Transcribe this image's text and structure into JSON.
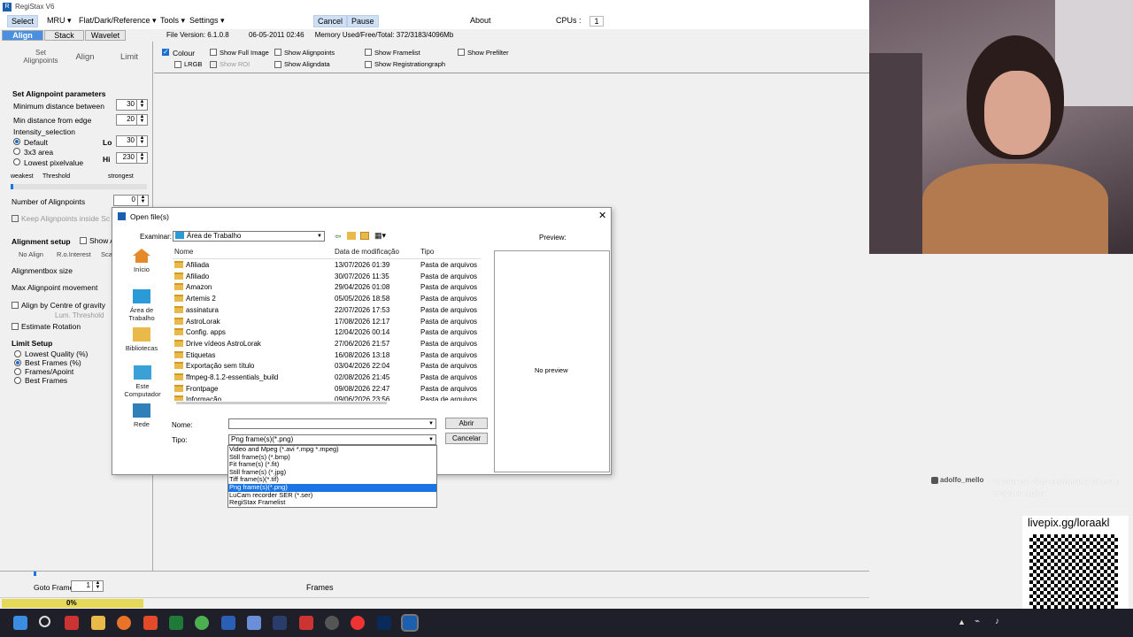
{
  "window": {
    "title": "RegiStax V6"
  },
  "menubar": {
    "select": "Select",
    "mru": "MRU ▾",
    "flat": "Flat/Dark/Reference ▾",
    "tools": "Tools ▾",
    "settings": "Settings ▾",
    "cancel": "Cancel",
    "pause": "Pause",
    "about": "About",
    "cpus_label": "CPUs :",
    "cpus_value": "1"
  },
  "tabs": {
    "align": "Align",
    "stack": "Stack",
    "wavelet": "Wavelet"
  },
  "fileinfo": {
    "version": "File Version: 6.1.0.8",
    "date": "06-05-2011 02:46",
    "memory": "Memory Used/Free/Total: 372/3183/4096Mb"
  },
  "left": {
    "set_alignpoints": "Set Alignpoints",
    "align": "Align",
    "limit": "Limit",
    "params_title": "Set Alignpoint parameters",
    "min_dist_between": "Minimum distance between",
    "min_dist_between_val": "30",
    "min_dist_edge": "Min distance from edge",
    "min_dist_edge_val": "20",
    "intensity": "Intensity_selection",
    "default": "Default",
    "area3x3": "3x3 area",
    "lowest": "Lowest pixelvalue",
    "lo": "Lo",
    "lo_val": "30",
    "hi": "Hi",
    "hi_val": "230",
    "weakest": "weakest",
    "threshold": "Threshold",
    "strongest": "strongest",
    "num_alignpoints": "Number of Alignpoints",
    "num_alignpoints_val": "0",
    "keep_inside": "Keep Alignpoints inside Sc",
    "alignment_setup": "Alignment setup",
    "show_a": "Show A",
    "no_align": "No Align",
    "roi": "R.o.Interest",
    "sca": "Sca",
    "alignbox_size": "Alignmentbox size",
    "max_movement": "Max Alignpoint movement",
    "align_centre": "Align by Centre of gravity",
    "lum_threshold": "Lum. Threshold",
    "estimate_rotation": "Estimate Rotation",
    "limit_setup": "Limit Setup",
    "lowest_quality": "Lowest Quality (%)",
    "best_frames_pct": "Best Frames (%)",
    "frames_apoint": "Frames/Apoint",
    "best_frames": "Best Frames"
  },
  "topchecks": {
    "colour": "Colour",
    "lrgb": "LRGB",
    "show_full": "Show Full Image",
    "show_roi": "Show ROI",
    "show_alignpoints": "Show Alignpoints",
    "show_aligndata": "Show Aligndata",
    "show_framelist": "Show Framelist",
    "show_reggraph": "Show Registrationgraph",
    "show_prefilter": "Show Prefilter"
  },
  "dialog": {
    "title": "Open file(s)",
    "examinar": "Examinar:",
    "location": "Área de Trabalho",
    "preview": "Preview:",
    "no_preview": "No preview",
    "nav": [
      {
        "label": "Início"
      },
      {
        "label": "Área de Trabalho"
      },
      {
        "label": "Bibliotecas"
      },
      {
        "label": "Este Computador"
      },
      {
        "label": "Rede"
      }
    ],
    "headers": {
      "name": "Nome",
      "date": "Data de modificação",
      "type": "Tipo"
    },
    "files": [
      {
        "name": "Afiliada",
        "date": "13/07/2026 01:39",
        "type": "Pasta de arquivos"
      },
      {
        "name": "Afiliado",
        "date": "30/07/2026 11:35",
        "type": "Pasta de arquivos"
      },
      {
        "name": "Amazon",
        "date": "29/04/2026 01:08",
        "type": "Pasta de arquivos"
      },
      {
        "name": "Artemis 2",
        "date": "05/05/2026 18:58",
        "type": "Pasta de arquivos"
      },
      {
        "name": "assinatura",
        "date": "22/07/2026 17:53",
        "type": "Pasta de arquivos"
      },
      {
        "name": "AstroLorak",
        "date": "17/08/2026 12:17",
        "type": "Pasta de arquivos"
      },
      {
        "name": "Config. apps",
        "date": "12/04/2026 00:14",
        "type": "Pasta de arquivos"
      },
      {
        "name": "Drive vídeos AstroLorak",
        "date": "27/06/2026 21:57",
        "type": "Pasta de arquivos"
      },
      {
        "name": "Etiquetas",
        "date": "16/08/2026 13:18",
        "type": "Pasta de arquivos"
      },
      {
        "name": "Exportação sem título",
        "date": "03/04/2026 22:04",
        "type": "Pasta de arquivos"
      },
      {
        "name": "ffmpeg-8.1.2-essentials_build",
        "date": "02/08/2026 21:45",
        "type": "Pasta de arquivos"
      },
      {
        "name": "Frontpage",
        "date": "09/08/2026 22:47",
        "type": "Pasta de arquivos"
      },
      {
        "name": "Informação",
        "date": "09/06/2026 23:56",
        "type": "Pasta de arquivos"
      }
    ],
    "nome_label": "Nome:",
    "nome_value": "",
    "tipo_label": "Tipo:",
    "tipo_value": "Png frame(s)(*.png)",
    "abrir": "Abrir",
    "cancelar": "Cancelar",
    "types": [
      {
        "label": "Video and Mpeg (*.avi *.mpg *.mpeg)",
        "selected": false
      },
      {
        "label": "Still frame(s) (*.bmp)",
        "selected": false
      },
      {
        "label": "Fit frame(s) (*.fit)",
        "selected": false
      },
      {
        "label": "Still frame(s) (*.jpg)",
        "selected": false
      },
      {
        "label": "Tiff frame(s)(*.tif)",
        "selected": false
      },
      {
        "label": "Png frame(s)(*.png)",
        "selected": true
      },
      {
        "label": "LuCam recorder SER (*.ser)",
        "selected": false
      },
      {
        "label": "RegiStax Framelist",
        "selected": false
      }
    ]
  },
  "bottom": {
    "goto_frame": "Goto Frame",
    "goto_val": "1",
    "frames": "Frames",
    "progress": "0%"
  },
  "stream": {
    "chat_user": "adolfo_mello",
    "chat_text": "vc tinha um vídeo ensinando a colocar o tempo no regista",
    "livepix": "livepix.gg/loraakl"
  },
  "colors": {
    "accent": "#1a74e3",
    "tab_active": "#4a90e2",
    "taskbar": "#1f1f2a"
  }
}
